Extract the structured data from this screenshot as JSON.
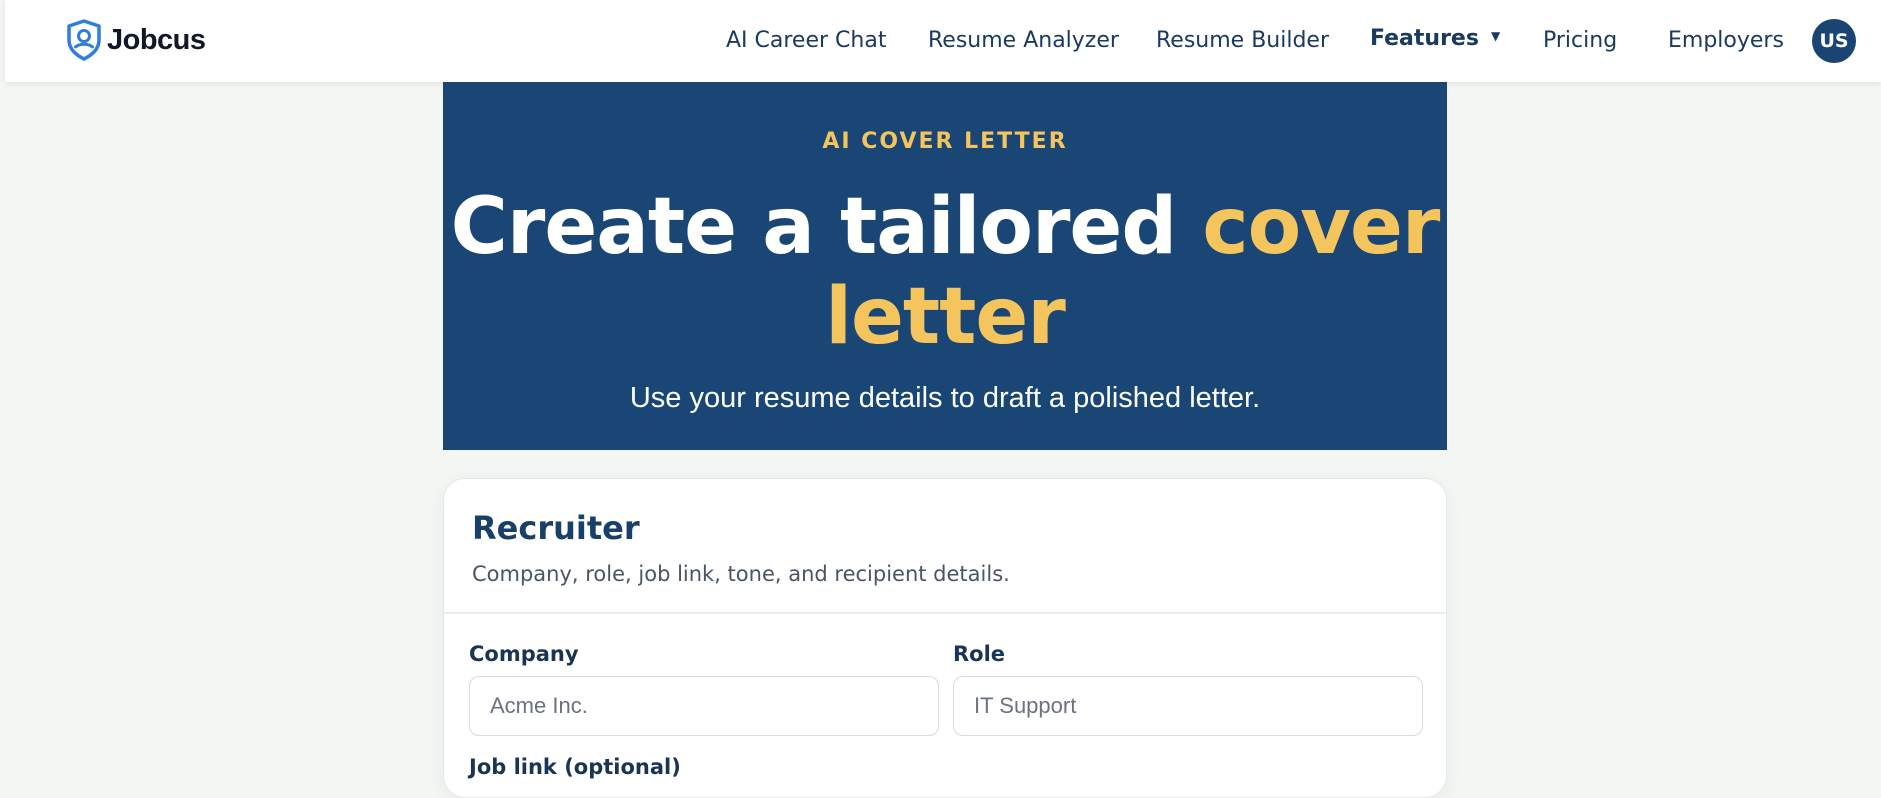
{
  "brand": {
    "name": "Jobcus",
    "logo_icon": "shield-pin-icon"
  },
  "nav": {
    "items": [
      {
        "label": "AI Career Chat"
      },
      {
        "label": "Resume Analyzer"
      },
      {
        "label": "Resume Builder"
      },
      {
        "label": "Features"
      },
      {
        "label": "Pricing"
      },
      {
        "label": "Employers"
      }
    ],
    "features_caret": "▼",
    "avatar_initials": "US"
  },
  "hero": {
    "eyebrow": "AI COVER LETTER",
    "title_part1": "Create a tailored ",
    "title_accent": "cover letter",
    "subtitle": "Use your resume details to draft a polished letter."
  },
  "recruiter": {
    "title": "Recruiter",
    "description": "Company, role, job link, tone, and recipient details.",
    "company_label": "Company",
    "company_placeholder": "Acme Inc.",
    "role_label": "Role",
    "role_placeholder": "IT Support",
    "job_link_label": "Job link (optional)"
  },
  "colors": {
    "navy": "#1a4675",
    "accent_yellow": "#f4c45d",
    "page_bg": "#f3f6f2"
  }
}
